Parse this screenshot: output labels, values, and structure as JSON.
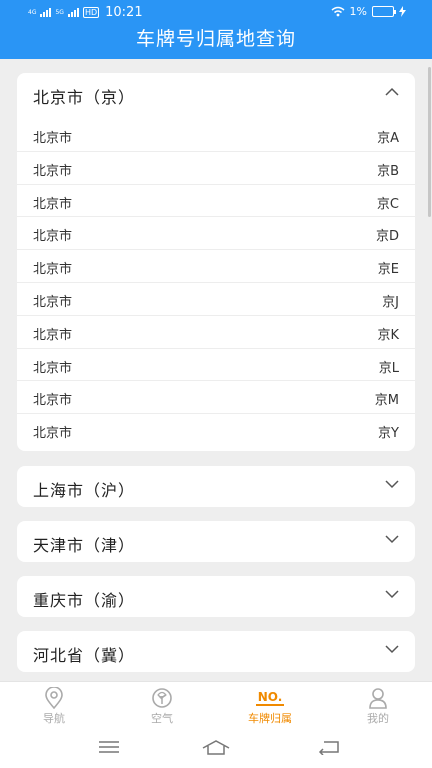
{
  "status": {
    "net1": "4G",
    "net2": "5G",
    "hd": "HD",
    "time": "10:21",
    "battery": "1%"
  },
  "header": {
    "title": "车牌号归属地查询"
  },
  "expanded": {
    "name": "北京市（京）",
    "rows": [
      {
        "city": "北京市",
        "code": "京A"
      },
      {
        "city": "北京市",
        "code": "京B"
      },
      {
        "city": "北京市",
        "code": "京C"
      },
      {
        "city": "北京市",
        "code": "京D"
      },
      {
        "city": "北京市",
        "code": "京E"
      },
      {
        "city": "北京市",
        "code": "京J"
      },
      {
        "city": "北京市",
        "code": "京K"
      },
      {
        "city": "北京市",
        "code": "京L"
      },
      {
        "city": "北京市",
        "code": "京M"
      },
      {
        "city": "北京市",
        "code": "京Y"
      }
    ]
  },
  "collapsed": [
    {
      "name": "上海市（沪）"
    },
    {
      "name": "天津市（津）"
    },
    {
      "name": "重庆市（渝）"
    },
    {
      "name": "河北省（冀）"
    }
  ],
  "tabs": [
    {
      "label": "导航",
      "icon": "location-pin-icon"
    },
    {
      "label": "空气",
      "icon": "leaf-icon"
    },
    {
      "label": "车牌归属",
      "icon": "no-icon",
      "icon_text": "NO."
    },
    {
      "label": "我的",
      "icon": "person-icon"
    }
  ],
  "colors": {
    "header": "#2a95f5",
    "active_tab": "#f08a00",
    "inactive_tab": "#aaaaaa"
  }
}
